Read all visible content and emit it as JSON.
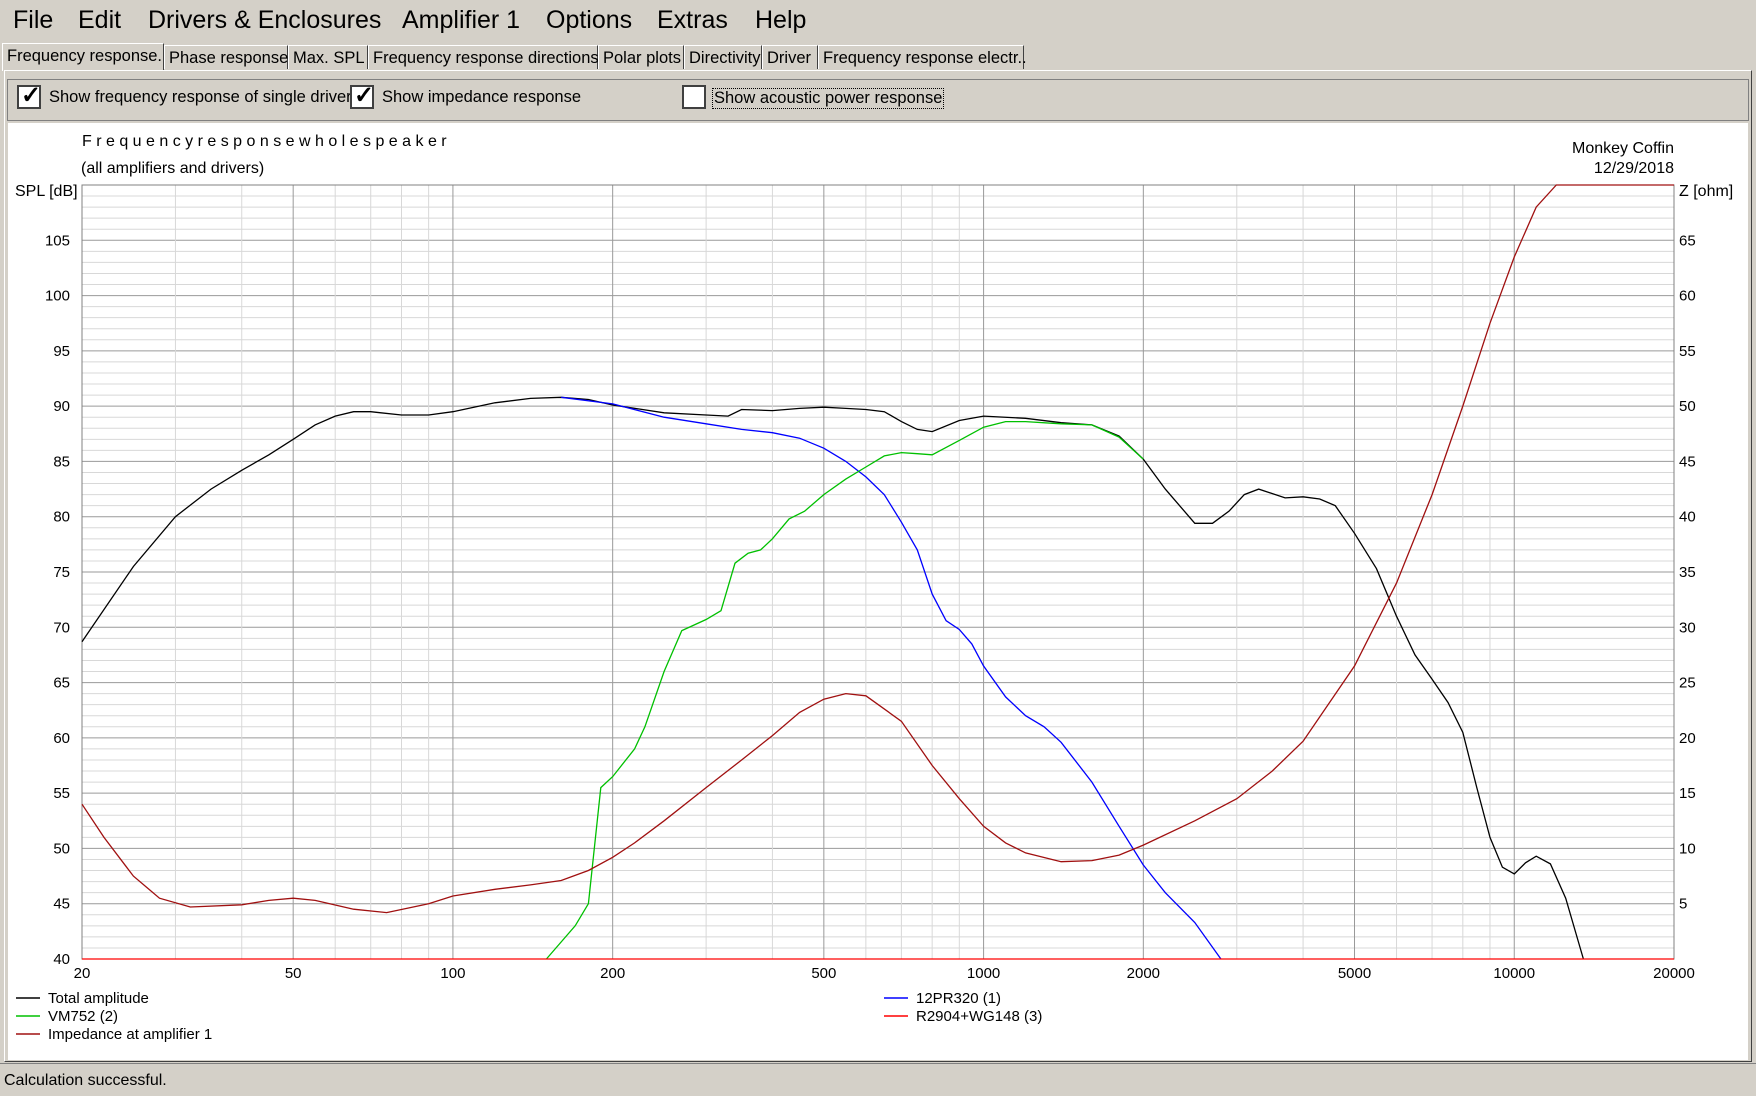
{
  "menu": [
    "File",
    "Edit",
    "Drivers & Enclosures",
    "Amplifier 1",
    "Options",
    "Extras",
    "Help"
  ],
  "tabs": [
    "Frequency response.",
    "Phase response",
    "Max. SPL",
    "Frequency response directions",
    "Polar plots",
    "Directivity",
    "Driver",
    "Frequency response electr.."
  ],
  "options": {
    "show_single_driver": {
      "label": "Show frequency response of single driver",
      "checked": true
    },
    "show_impedance": {
      "label": "Show impedance response",
      "checked": true
    },
    "show_acoustic_power": {
      "label": "Show acoustic power response",
      "checked": false
    }
  },
  "chart_header": {
    "title": "F r e q u e n c y   r e s p o n s e   w h o l e   s p e a k e r",
    "subtitle": "(all amplifiers and drivers)",
    "project": "Monkey Coffin",
    "date": "12/29/2018"
  },
  "status": "Calculation successful.",
  "chart_data": {
    "type": "line",
    "xscale": "log",
    "xlim": [
      20,
      20000
    ],
    "xticks": [
      20,
      50,
      100,
      200,
      500,
      1000,
      2000,
      5000,
      10000,
      20000
    ],
    "ylabel": "SPL [dB]",
    "ylim": [
      40,
      110
    ],
    "yticks": [
      40,
      45,
      50,
      55,
      60,
      65,
      70,
      75,
      80,
      85,
      90,
      95,
      100,
      105
    ],
    "y2label": "Z [ohm]",
    "y2lim": [
      0,
      70
    ],
    "y2ticks": [
      5,
      10,
      15,
      20,
      25,
      30,
      35,
      40,
      45,
      50,
      55,
      60,
      65
    ],
    "grid": true,
    "legend_position": "bottom",
    "series": [
      {
        "name": "Total amplitude",
        "color": "#000000",
        "axis": "left",
        "points": [
          [
            20,
            68.7
          ],
          [
            25,
            75.5
          ],
          [
            30,
            80
          ],
          [
            35,
            82.5
          ],
          [
            40,
            84.2
          ],
          [
            45,
            85.6
          ],
          [
            50,
            87
          ],
          [
            55,
            88.3
          ],
          [
            60,
            89.1
          ],
          [
            65,
            89.5
          ],
          [
            70,
            89.5
          ],
          [
            80,
            89.2
          ],
          [
            90,
            89.2
          ],
          [
            100,
            89.5
          ],
          [
            120,
            90.3
          ],
          [
            140,
            90.7
          ],
          [
            160,
            90.8
          ],
          [
            180,
            90.6
          ],
          [
            200,
            90.1
          ],
          [
            250,
            89.4
          ],
          [
            300,
            89.2
          ],
          [
            330,
            89.1
          ],
          [
            350,
            89.7
          ],
          [
            400,
            89.6
          ],
          [
            450,
            89.8
          ],
          [
            500,
            89.9
          ],
          [
            550,
            89.8
          ],
          [
            600,
            89.7
          ],
          [
            650,
            89.5
          ],
          [
            700,
            88.6
          ],
          [
            750,
            87.9
          ],
          [
            800,
            87.7
          ],
          [
            900,
            88.7
          ],
          [
            1000,
            89.1
          ],
          [
            1200,
            88.9
          ],
          [
            1400,
            88.5
          ],
          [
            1600,
            88.3
          ],
          [
            1800,
            87.3
          ],
          [
            2000,
            85.2
          ],
          [
            2200,
            82.5
          ],
          [
            2500,
            79.4
          ],
          [
            2700,
            79.4
          ],
          [
            2900,
            80.5
          ],
          [
            3100,
            82
          ],
          [
            3300,
            82.5
          ],
          [
            3700,
            81.7
          ],
          [
            4000,
            81.8
          ],
          [
            4300,
            81.6
          ],
          [
            4600,
            81
          ],
          [
            5000,
            78.5
          ],
          [
            5500,
            75.3
          ],
          [
            6000,
            71
          ],
          [
            6500,
            67.5
          ],
          [
            7000,
            65.3
          ],
          [
            7500,
            63.2
          ],
          [
            8000,
            60.5
          ],
          [
            8500,
            55.5
          ],
          [
            9000,
            51
          ],
          [
            9500,
            48.3
          ],
          [
            10000,
            47.7
          ],
          [
            10500,
            48.7
          ],
          [
            11000,
            49.3
          ],
          [
            11700,
            48.6
          ],
          [
            12500,
            45.5
          ],
          [
            13500,
            40
          ]
        ]
      },
      {
        "name": "12PR320 (1)",
        "color": "#0000ff",
        "axis": "left",
        "points": [
          [
            160,
            90.8
          ],
          [
            200,
            90.2
          ],
          [
            250,
            89
          ],
          [
            300,
            88.4
          ],
          [
            350,
            87.9
          ],
          [
            400,
            87.6
          ],
          [
            450,
            87.1
          ],
          [
            500,
            86.2
          ],
          [
            550,
            85
          ],
          [
            600,
            83.6
          ],
          [
            650,
            82
          ],
          [
            700,
            79.5
          ],
          [
            750,
            77
          ],
          [
            800,
            73
          ],
          [
            850,
            70.6
          ],
          [
            900,
            69.8
          ],
          [
            950,
            68.5
          ],
          [
            1000,
            66.5
          ],
          [
            1100,
            63.7
          ],
          [
            1200,
            62
          ],
          [
            1300,
            61
          ],
          [
            1400,
            59.6
          ],
          [
            1600,
            56
          ],
          [
            1800,
            52
          ],
          [
            2000,
            48.5
          ],
          [
            2200,
            46
          ],
          [
            2500,
            43.3
          ],
          [
            2800,
            40
          ]
        ]
      },
      {
        "name": "VM752 (2)",
        "color": "#00c000",
        "axis": "left",
        "points": [
          [
            150,
            40
          ],
          [
            170,
            43
          ],
          [
            180,
            45
          ],
          [
            190,
            55.5
          ],
          [
            200,
            56.5
          ],
          [
            220,
            59
          ],
          [
            230,
            61
          ],
          [
            250,
            66
          ],
          [
            270,
            69.7
          ],
          [
            300,
            70.7
          ],
          [
            320,
            71.5
          ],
          [
            340,
            75.8
          ],
          [
            360,
            76.7
          ],
          [
            380,
            77
          ],
          [
            400,
            78
          ],
          [
            430,
            79.8
          ],
          [
            460,
            80.5
          ],
          [
            500,
            82
          ],
          [
            550,
            83.4
          ],
          [
            600,
            84.5
          ],
          [
            650,
            85.5
          ],
          [
            700,
            85.8
          ],
          [
            750,
            85.7
          ],
          [
            800,
            85.6
          ],
          [
            900,
            86.9
          ],
          [
            1000,
            88.1
          ],
          [
            1100,
            88.6
          ],
          [
            1200,
            88.6
          ],
          [
            1400,
            88.4
          ],
          [
            1600,
            88.3
          ],
          [
            1800,
            87.2
          ],
          [
            2000,
            85.2
          ]
        ]
      },
      {
        "name": "R2904+WG148 (3)",
        "color": "#ff0000",
        "axis": "left",
        "points": [
          [
            20,
            40
          ],
          [
            20000,
            40
          ]
        ]
      },
      {
        "name": "Impedance at amplifier 1",
        "color": "#a01010",
        "axis": "right",
        "points": [
          [
            20,
            14
          ],
          [
            22,
            11
          ],
          [
            25,
            7.5
          ],
          [
            28,
            5.5
          ],
          [
            32,
            4.7
          ],
          [
            40,
            4.9
          ],
          [
            45,
            5.3
          ],
          [
            50,
            5.5
          ],
          [
            55,
            5.3
          ],
          [
            65,
            4.5
          ],
          [
            75,
            4.2
          ],
          [
            90,
            5
          ],
          [
            100,
            5.7
          ],
          [
            120,
            6.3
          ],
          [
            140,
            6.7
          ],
          [
            160,
            7.1
          ],
          [
            180,
            8
          ],
          [
            200,
            9.2
          ],
          [
            220,
            10.5
          ],
          [
            250,
            12.5
          ],
          [
            300,
            15.5
          ],
          [
            350,
            18
          ],
          [
            400,
            20.2
          ],
          [
            450,
            22.3
          ],
          [
            500,
            23.5
          ],
          [
            550,
            24
          ],
          [
            600,
            23.8
          ],
          [
            700,
            21.5
          ],
          [
            800,
            17.5
          ],
          [
            900,
            14.5
          ],
          [
            1000,
            12
          ],
          [
            1100,
            10.5
          ],
          [
            1200,
            9.6
          ],
          [
            1400,
            8.8
          ],
          [
            1600,
            8.9
          ],
          [
            1800,
            9.4
          ],
          [
            2000,
            10.3
          ],
          [
            2500,
            12.5
          ],
          [
            3000,
            14.5
          ],
          [
            3500,
            17
          ],
          [
            4000,
            19.7
          ],
          [
            5000,
            26.5
          ],
          [
            6000,
            34
          ],
          [
            7000,
            42
          ],
          [
            8000,
            50
          ],
          [
            9000,
            57.5
          ],
          [
            10000,
            63.5
          ],
          [
            11000,
            68
          ],
          [
            12000,
            70
          ],
          [
            20000,
            70
          ]
        ]
      }
    ]
  }
}
